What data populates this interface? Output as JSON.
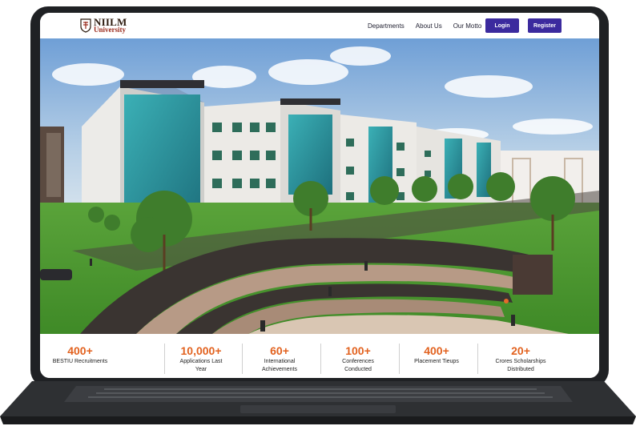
{
  "brand": {
    "name": "NIILM",
    "subtitle": "University",
    "crest_icon": "shield-crest-icon"
  },
  "nav": {
    "links": [
      "Departments",
      "About Us",
      "Our Motto"
    ],
    "login_label": "Login",
    "register_label": "Register"
  },
  "colors": {
    "accent": "#3b2a9e",
    "stat_value": "#e2621f",
    "laptop_frame": "#1f2124"
  },
  "stats": [
    {
      "value": "400+",
      "label": "BESTIU Recruitments"
    },
    {
      "value": "10,000+",
      "label": "Applications Last Year"
    },
    {
      "value": "60+",
      "label": "International Achievements"
    },
    {
      "value": "100+",
      "label": "Conferences Conducted"
    },
    {
      "value": "400+",
      "label": "Placement Tieups"
    },
    {
      "value": "20+",
      "label": "Crores Scholarships Distributed"
    }
  ]
}
